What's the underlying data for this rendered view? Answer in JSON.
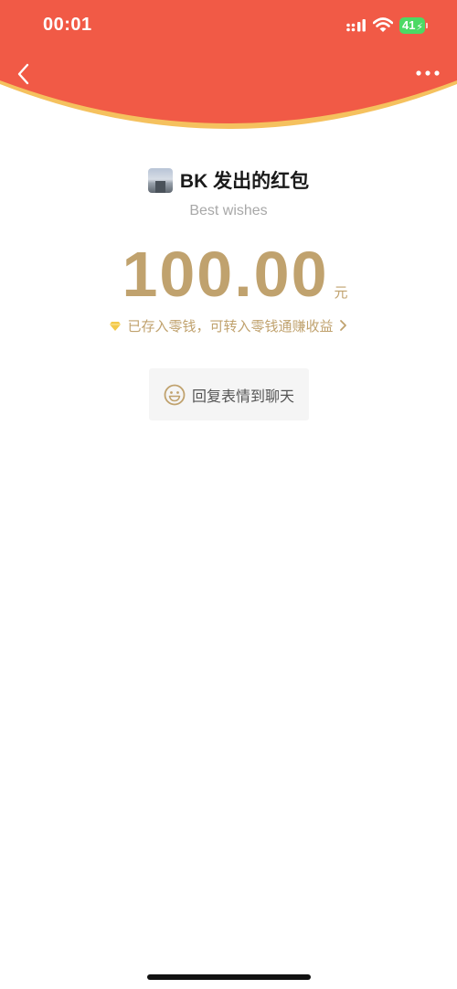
{
  "status_bar": {
    "time": "00:01",
    "battery_level": "41"
  },
  "colors": {
    "header_red": "#f15a46",
    "header_gold_edge": "#f5c15e",
    "accent_gold": "#c0a26e",
    "battery_green": "#4cd964"
  },
  "nav": {
    "back_icon": "chevron-left-icon",
    "more_icon": "more-dots-icon"
  },
  "packet": {
    "sender_title": "BK 发出的红包",
    "wishes": "Best wishes",
    "amount": "100.00",
    "unit": "元",
    "change_note": "已存入零钱，可转入零钱通赚收益",
    "reply_label": "回复表情到聊天"
  }
}
